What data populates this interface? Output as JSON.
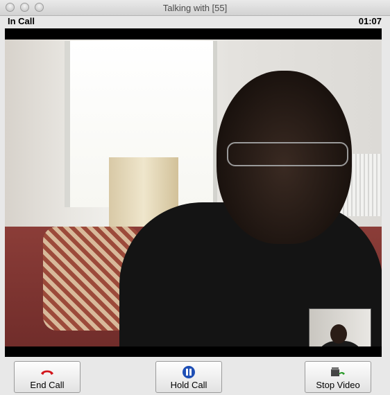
{
  "window": {
    "title": "Talking with [55]"
  },
  "call": {
    "status": "In Call",
    "elapsed": "01:07"
  },
  "video": {
    "remote_feed": "remote-video",
    "local_feed": "local-preview"
  },
  "buttons": {
    "end_call": {
      "label": "End Call",
      "icon": "end-call-icon",
      "color": "#d2151b"
    },
    "hold_call": {
      "label": "Hold Call",
      "icon": "pause-icon",
      "color": "#1f4fb5"
    },
    "stop_video": {
      "label": "Stop Video",
      "icon": "video-call-icon",
      "color": "#2a9a2a"
    }
  }
}
